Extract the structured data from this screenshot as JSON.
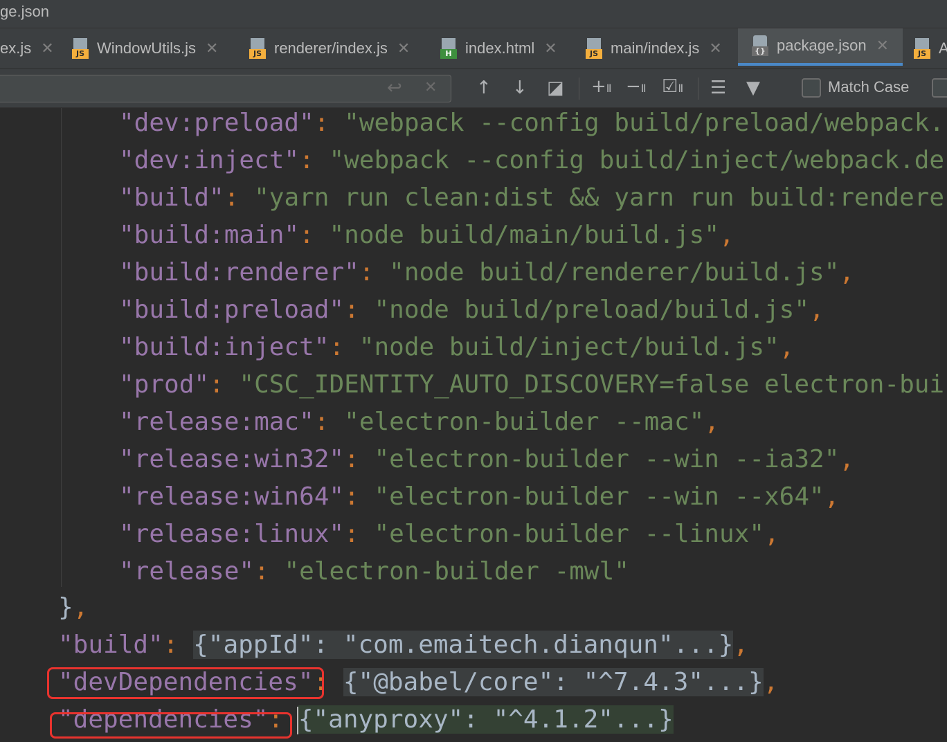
{
  "window": {
    "title": "ge.json"
  },
  "tabs": [
    {
      "label": "ex.js"
    },
    {
      "label": "WindowUtils.js",
      "badge": "JS"
    },
    {
      "label": "renderer/index.js",
      "badge": "JS"
    },
    {
      "label": "index.html",
      "badge": "H"
    },
    {
      "label": "main/index.js",
      "badge": "JS"
    },
    {
      "label": "package.json",
      "badge": "{}"
    },
    {
      "label": "A",
      "badge": "JS"
    }
  ],
  "search": {
    "value": "",
    "match_case_label": "Match Case",
    "match_case_checked": false
  },
  "code": {
    "scripts": [
      {
        "key": "\"dev:preload\"",
        "value": "\"webpack --config build/preload/webpack."
      },
      {
        "key": "\"dev:inject\"",
        "value": "\"webpack --config build/inject/webpack.de"
      },
      {
        "key": "\"build\"",
        "value": "\"yarn run clean:dist && yarn run build:rendere"
      },
      {
        "key": "\"build:main\"",
        "value": "\"node build/main/build.js\"",
        "comma": ","
      },
      {
        "key": "\"build:renderer\"",
        "value": "\"node build/renderer/build.js\"",
        "comma": ","
      },
      {
        "key": "\"build:preload\"",
        "value": "\"node build/preload/build.js\"",
        "comma": ","
      },
      {
        "key": "\"build:inject\"",
        "value": "\"node build/inject/build.js\"",
        "comma": ","
      },
      {
        "key": "\"prod\"",
        "value": "\"CSC_IDENTITY_AUTO_DISCOVERY=false electron-bui"
      },
      {
        "key": "\"release:mac\"",
        "value": "\"electron-builder --mac\"",
        "comma": ","
      },
      {
        "key": "\"release:win32\"",
        "value": "\"electron-builder --win --ia32\"",
        "comma": ","
      },
      {
        "key": "\"release:win64\"",
        "value": "\"electron-builder --win --x64\"",
        "comma": ","
      },
      {
        "key": "\"release:linux\"",
        "value": "\"electron-builder --linux\"",
        "comma": ","
      },
      {
        "key": "\"release\"",
        "value": "\"electron-builder -mwl\""
      }
    ],
    "close_scripts": "}",
    "close_comma": ",",
    "build_key": "\"build\"",
    "build_fold": "{\"appId\": \"com.emaitech.dianqun\"...}",
    "dev_deps_key": "\"devDependencies\"",
    "dev_deps_fold": "{\"@babel/core\": \"^7.4.3\"...}",
    "deps_key": "\"dependencies\"",
    "deps_fold": "{\"anyproxy\": \"^4.1.2\"...}",
    "colon": ":",
    "comma": ","
  },
  "colors": {
    "key": "#9876aa",
    "string": "#6a8759",
    "punct": "#cc7832",
    "highlight_box": "#e8332e",
    "active_tab_underline": "#4a88c7"
  }
}
